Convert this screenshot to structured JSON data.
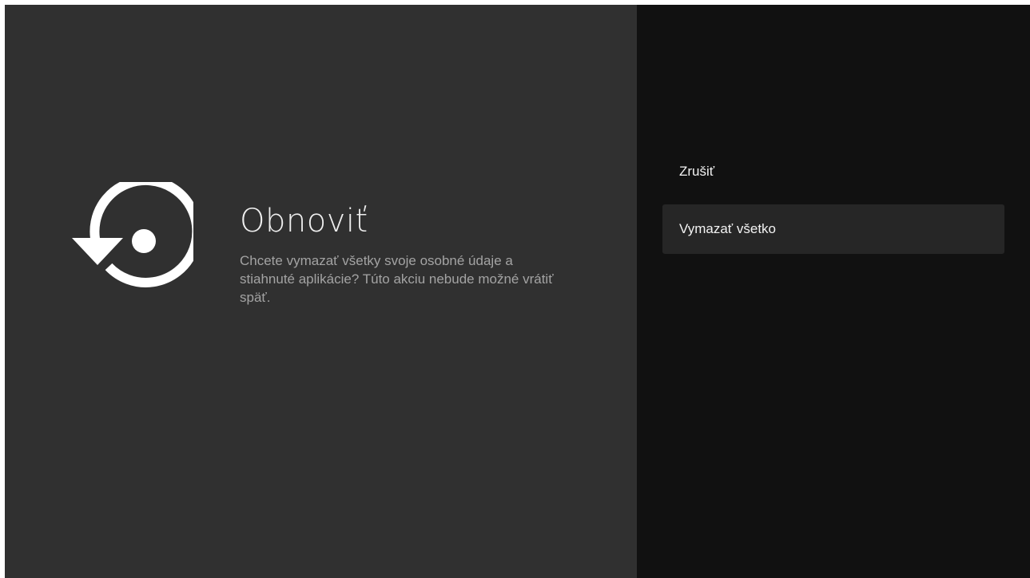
{
  "dialog": {
    "icon": "restore-icon",
    "title": "Obnoviť",
    "description": "Chcete vymazať všetky svoje osobné údaje a stiahnuté aplikácie? Túto akciu nebude možné vrátiť späť."
  },
  "actions": [
    {
      "label": "Zrušiť",
      "focused": false
    },
    {
      "label": "Vymazať všetko",
      "focused": true
    }
  ],
  "colors": {
    "left_background": "#303030",
    "right_background": "#111111",
    "focused_item": "#262626",
    "title_text": "#eeeeee",
    "description_text": "#a3a3a3"
  }
}
